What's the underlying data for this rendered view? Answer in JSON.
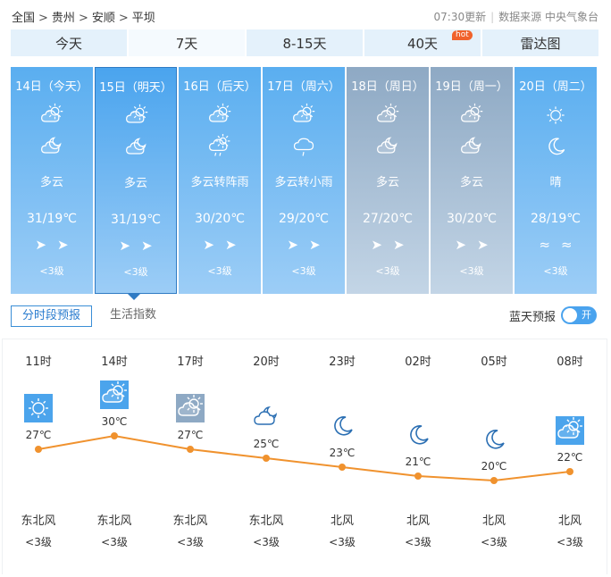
{
  "breadcrumb": {
    "items": [
      "全国",
      "贵州",
      "安顺",
      "平坝"
    ],
    "sep": ">"
  },
  "header": {
    "update_time": "07:30更新",
    "source": "数据来源 中央气象台"
  },
  "tabs": [
    {
      "label": "今天"
    },
    {
      "label": "7天"
    },
    {
      "label": "8-15天"
    },
    {
      "label": "40天",
      "badge": "hot"
    },
    {
      "label": "雷达图"
    }
  ],
  "days": [
    {
      "date": "14日（今天）",
      "icon1": "partly-cloudy-day-icon",
      "icon2": "partly-cloudy-night-icon",
      "desc": "多云",
      "temp": "31/19℃",
      "wind": [
        "➤",
        "➤"
      ],
      "level": "<3级",
      "style": "normal"
    },
    {
      "date": "15日（明天）",
      "icon1": "partly-cloudy-day-icon",
      "icon2": "partly-cloudy-night-icon",
      "desc": "多云",
      "temp": "31/19℃",
      "wind": [
        "➤",
        "➤"
      ],
      "level": "<3级",
      "style": "selected"
    },
    {
      "date": "16日（后天）",
      "icon1": "partly-cloudy-day-icon",
      "icon2": "shower-icon",
      "desc": "多云转阵雨",
      "temp": "30/20℃",
      "wind": [
        "➤",
        "➤"
      ],
      "level": "<3级",
      "style": "normal"
    },
    {
      "date": "17日（周六）",
      "icon1": "partly-cloudy-day-icon",
      "icon2": "light-rain-icon",
      "desc": "多云转小雨",
      "temp": "29/20℃",
      "wind": [
        "➤",
        "➤"
      ],
      "level": "<3级",
      "style": "normal"
    },
    {
      "date": "18日（周日）",
      "icon1": "partly-cloudy-day-icon",
      "icon2": "partly-cloudy-night-icon",
      "desc": "多云",
      "temp": "27/20℃",
      "wind": [
        "➤",
        "➤"
      ],
      "level": "<3级",
      "style": "weekend"
    },
    {
      "date": "19日（周一）",
      "icon1": "partly-cloudy-day-icon",
      "icon2": "partly-cloudy-night-icon",
      "desc": "多云",
      "temp": "30/20℃",
      "wind": [
        "➤",
        "➤"
      ],
      "level": "<3级",
      "style": "weekend"
    },
    {
      "date": "20日（周二）",
      "icon1": "sun-icon",
      "icon2": "moon-icon",
      "desc": "晴",
      "temp": "28/19℃",
      "wind": [
        "≈",
        "≈"
      ],
      "level": "<3级",
      "style": "normal"
    }
  ],
  "subtabs": [
    {
      "label": "分时段预报"
    },
    {
      "label": "生活指数"
    }
  ],
  "lantian": {
    "label": "蓝天预报",
    "toggle": "开"
  },
  "hourly": {
    "hours": [
      "11时",
      "14时",
      "17时",
      "20时",
      "23时",
      "02时",
      "05时",
      "08时"
    ],
    "icons": [
      "sun-icon",
      "partly-cloudy-day-icon",
      "partly-cloudy-day-icon",
      "partly-cloudy-night-icon",
      "moon-icon",
      "moon-icon",
      "moon-icon",
      "partly-cloudy-day-icon"
    ],
    "temps": [
      27,
      30,
      27,
      25,
      23,
      21,
      20,
      22
    ],
    "temp_labels": [
      "27℃",
      "30℃",
      "27℃",
      "25℃",
      "23℃",
      "21℃",
      "20℃",
      "22℃"
    ],
    "wind_dirs": [
      "东北风",
      "东北风",
      "东北风",
      "东北风",
      "北风",
      "北风",
      "北风",
      "北风"
    ],
    "wind_levels": [
      "<3级",
      "<3级",
      "<3级",
      "<3级",
      "<3级",
      "<3级",
      "<3级",
      "<3级"
    ],
    "line_color": "#f0922e"
  },
  "colors": {
    "accent": "#3a8ed6",
    "tab_bg": "#e4f1fb",
    "hot": "#f0622c"
  }
}
